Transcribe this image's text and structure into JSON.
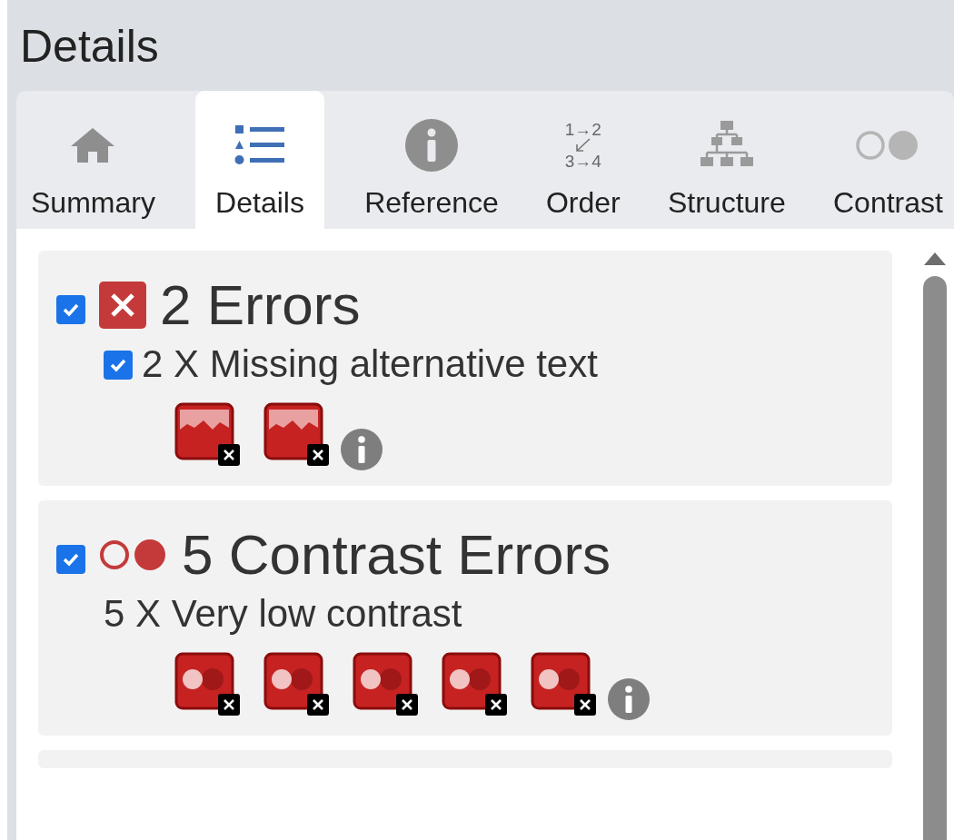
{
  "panel": {
    "title": "Details"
  },
  "tabs": [
    {
      "label": "Summary",
      "kind": "home",
      "selected": false
    },
    {
      "label": "Details",
      "kind": "list",
      "selected": true
    },
    {
      "label": "Reference",
      "kind": "info",
      "selected": false
    },
    {
      "label": "Order",
      "kind": "order",
      "icon_lines": [
        "1→2",
        "3→4"
      ],
      "selected": false
    },
    {
      "label": "Structure",
      "kind": "structure",
      "selected": false
    },
    {
      "label": "Contrast",
      "kind": "contrast",
      "selected": false
    }
  ],
  "categories": [
    {
      "kind": "error",
      "checked": true,
      "title": "2 Errors",
      "items": [
        {
          "checked": true,
          "label": "2 X Missing alternative text",
          "markers": [
            {
              "kind": "image"
            },
            {
              "kind": "image"
            }
          ]
        }
      ]
    },
    {
      "kind": "contrast",
      "checked": true,
      "title": "5 Contrast Errors",
      "items": [
        {
          "label": "5 X Very low contrast",
          "markers": [
            {
              "kind": "contrast"
            },
            {
              "kind": "contrast"
            },
            {
              "kind": "contrast"
            },
            {
              "kind": "contrast"
            },
            {
              "kind": "contrast"
            }
          ]
        }
      ]
    }
  ]
}
